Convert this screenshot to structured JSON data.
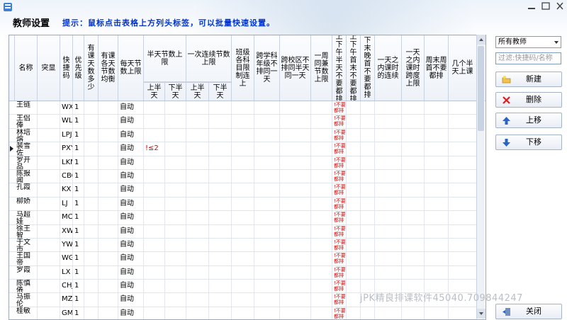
{
  "window": {
    "title": "教师设置",
    "hint": "提示：鼠标点击表格上方列头标签，可以批量快速设置。"
  },
  "columns": {
    "name": "名称",
    "highlight": "突显",
    "code": "快捷码",
    "priority": "优先级",
    "days_with_class": "有课天数多少",
    "balance": "有课各天节数均衡",
    "daily_max": "每天节数上限",
    "half_day_group": "半天节数上限",
    "half_day_am": "上半天",
    "half_day_pm": "下半天",
    "consecutive_group": "一次连续节数上限",
    "consec_am": "上半天",
    "consec_pm": "下半天",
    "class_limit": "班级各科目限制连上",
    "cross_subject": "跨学科年级不排同一天",
    "cross_campus": "跨校区不排同半天同一天",
    "weekly_max": "一周同兼节数上限",
    "am_pm_both": "上下午半天不要都排",
    "am_first_last": "上下午首末不要都排",
    "eve_first_last": "下末晚首不要都排",
    "one_day_consec": "一天之内课时的连续",
    "one_day_span": "一天之内课时跨度上限",
    "weekend_both": "周末周首不要都排",
    "half_days": "几个半天上课"
  },
  "red_text": "!不要都排",
  "rows": [
    {
      "name": "王链",
      "code": "WX",
      "priority": "1",
      "daily": "自动",
      "half_am": ""
    },
    {
      "name": "王侣俸",
      "code": "WLL",
      "priority": "1",
      "daily": "自动",
      "half_am": ""
    },
    {
      "name": "林培熔",
      "code": "LPJ",
      "priority": "1",
      "daily": "自动",
      "half_am": ""
    },
    {
      "name": "裴雪佐",
      "code": "PXY",
      "priority": "1",
      "daily": "自动",
      "half_am": "!≤2"
    },
    {
      "name": "罗开品",
      "code": "LKM",
      "priority": "1",
      "daily": "自动",
      "half_am": ""
    },
    {
      "name": "陈报闻",
      "code": "CBG",
      "priority": "1",
      "daily": "自动",
      "half_am": ""
    },
    {
      "name": "孔霞",
      "code": "KX",
      "priority": "1",
      "daily": "自动",
      "half_am": ""
    },
    {
      "name": "柳娇",
      "code": "LJ",
      "priority": "1",
      "daily": "自动",
      "half_am": ""
    },
    {
      "name": "马超娃",
      "code": "MC",
      "priority": "1",
      "daily": "自动",
      "half_am": ""
    },
    {
      "name": "徐王智",
      "code": "XW",
      "priority": "1",
      "daily": "自动",
      "half_am": ""
    },
    {
      "name": "于文市",
      "code": "YWF",
      "priority": "1",
      "daily": "自动",
      "half_am": ""
    },
    {
      "name": "王国帝",
      "code": "WGF",
      "priority": "1",
      "daily": "自动",
      "half_am": ""
    },
    {
      "name": "罗霞",
      "code": "LX",
      "priority": "1",
      "daily": "自动",
      "half_am": ""
    },
    {
      "name": "陈慎倦",
      "code": "CHJ",
      "priority": "1",
      "daily": "自动",
      "half_am": ""
    },
    {
      "name": "马振伦",
      "code": "MZH",
      "priority": "1",
      "daily": "自动",
      "half_am": ""
    },
    {
      "name": "桂敏",
      "code": "GM",
      "priority": "1",
      "daily": "自动",
      "half_am": ""
    }
  ],
  "panel": {
    "select_value": "所有教师",
    "filter_placeholder": "过滤:快捷码/名称",
    "new_label": "新建",
    "delete_label": "删除",
    "up_label": "上移",
    "down_label": "下移",
    "close_label": "关闭"
  },
  "watermark": "jPK精良排课软件45040.709844247",
  "colors": {
    "hint": "#0033cc",
    "red": "#e00000",
    "border": "#9aa9bf"
  }
}
